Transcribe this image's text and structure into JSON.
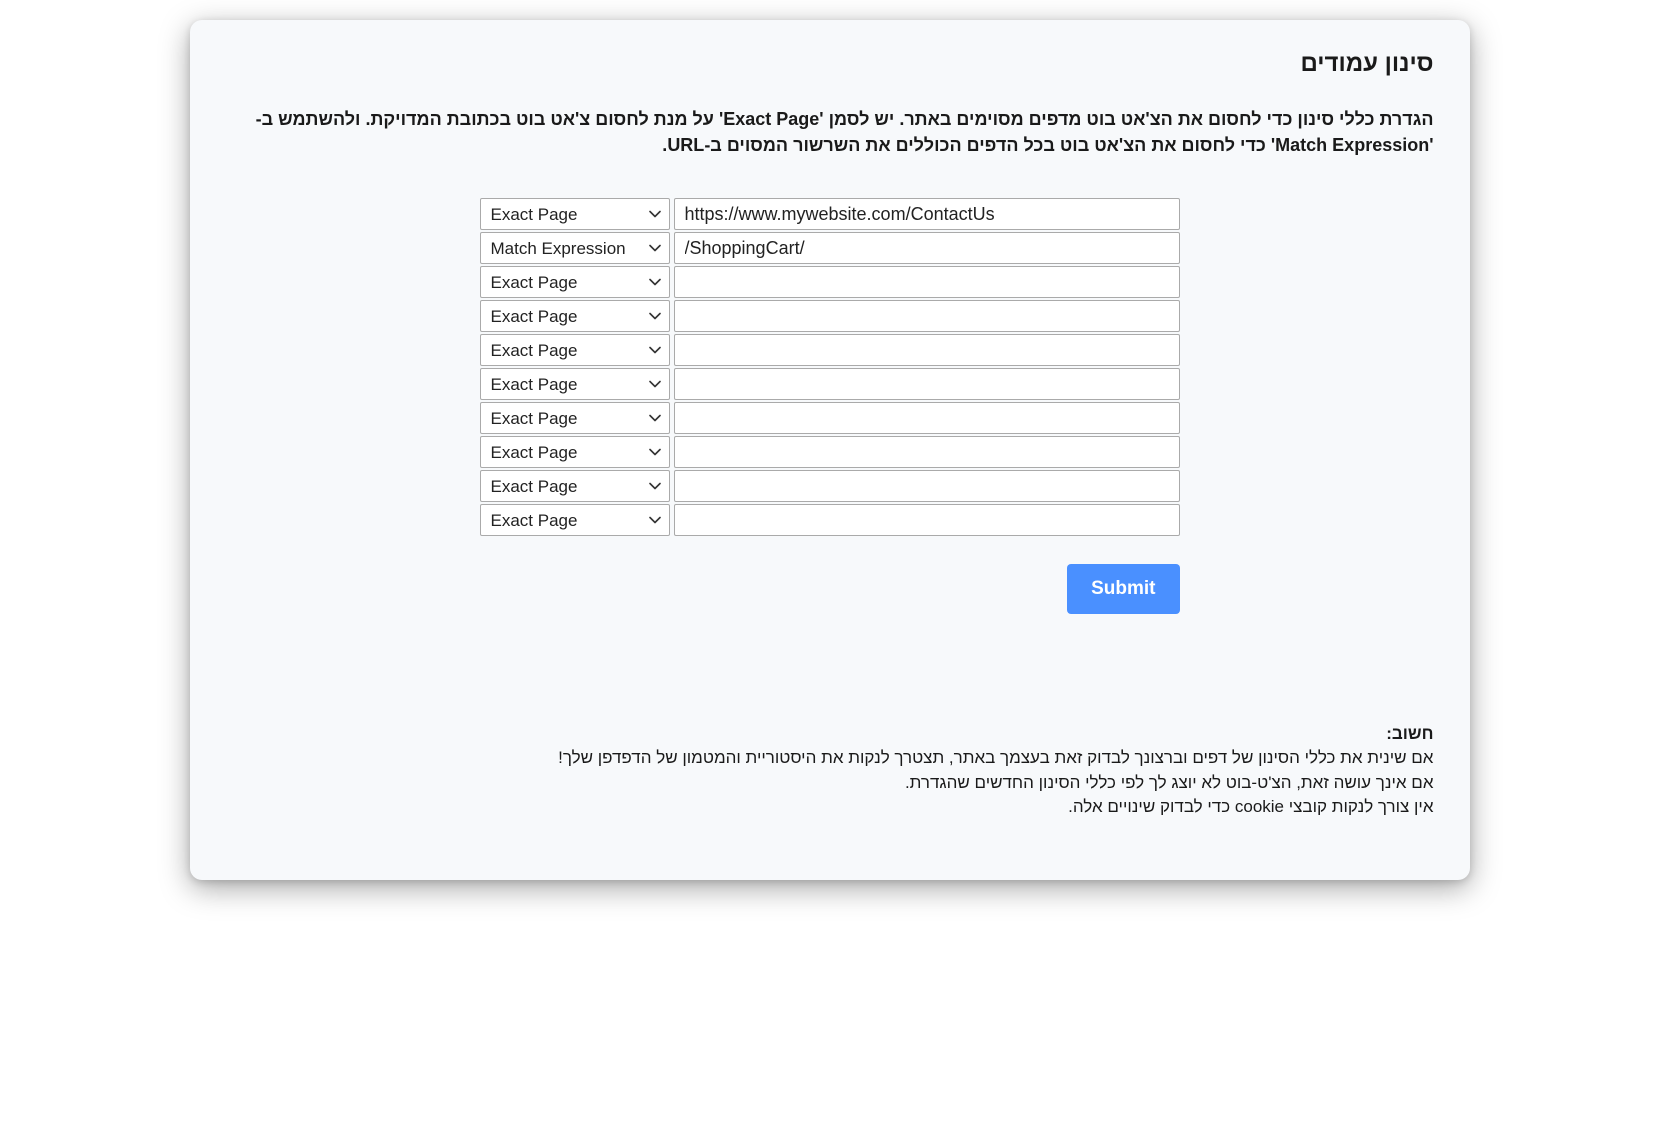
{
  "title": "סינון עמודים",
  "description": "הגדרת כללי סינון כדי לחסום את הצ'אט בוט מדפים מסוימים באתר. יש לסמן 'Exact Page' על מנת לחסום צ'אט בוט בכתובת המדויקת. ולהשתמש ב-'Match Expression' כדי לחסום את הצ'אט בוט בכל הדפים הכוללים את השרשור המסוים ב-URL.",
  "select_options": {
    "exact": "Exact Page",
    "match": "Match Expression"
  },
  "rows": [
    {
      "type": "exact",
      "value": "https://www.mywebsite.com/ContactUs"
    },
    {
      "type": "match",
      "value": "/ShoppingCart/"
    },
    {
      "type": "exact",
      "value": ""
    },
    {
      "type": "exact",
      "value": ""
    },
    {
      "type": "exact",
      "value": ""
    },
    {
      "type": "exact",
      "value": ""
    },
    {
      "type": "exact",
      "value": ""
    },
    {
      "type": "exact",
      "value": ""
    },
    {
      "type": "exact",
      "value": ""
    },
    {
      "type": "exact",
      "value": ""
    }
  ],
  "submit_label": "Submit",
  "note": {
    "heading": "חשוב:",
    "line1": "אם שינית את כללי הסינון של דפים וברצונך לבדוק זאת בעצמך באתר, תצטרך לנקות את היסטוריית והמטמון של הדפדפן שלך!",
    "line2": "אם אינך עושה זאת, הצ'ט-בוט לא יוצג לך לפי כללי הסינון החדשים שהגדרת.",
    "line3": "אין צורך לנקות קובצי cookie כדי לבדוק שינויים אלה."
  }
}
